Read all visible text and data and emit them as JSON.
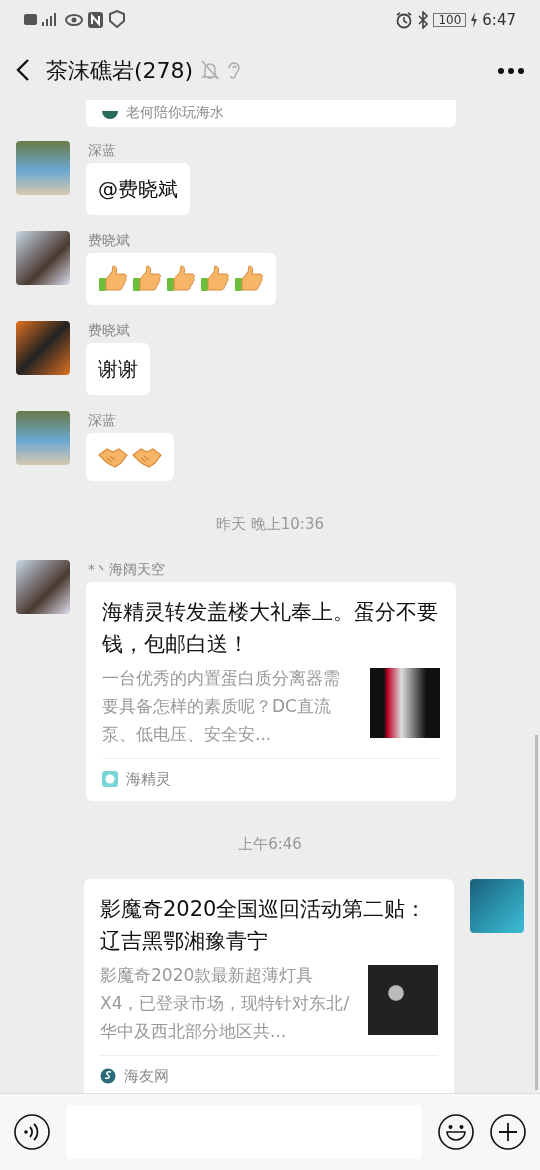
{
  "status_bar": {
    "battery": "100",
    "time": "6:47"
  },
  "header": {
    "title": "茶沫礁岩(278)"
  },
  "messages": [
    {
      "kind": "link_tail",
      "source": "老何陪你玩海水"
    },
    {
      "kind": "text",
      "outgoing": false,
      "sender": "深蓝",
      "text": "@费晓斌"
    },
    {
      "kind": "emoji",
      "outgoing": false,
      "sender": "费晓斌",
      "emoji": [
        {
          "kind": "thumb"
        },
        {
          "kind": "thumb"
        },
        {
          "kind": "thumb"
        },
        {
          "kind": "thumb"
        },
        {
          "kind": "thumb"
        }
      ]
    },
    {
      "kind": "text",
      "outgoing": false,
      "sender": "费晓斌",
      "text": "谢谢"
    },
    {
      "kind": "emoji",
      "outgoing": false,
      "sender": "深蓝",
      "emoji": [
        {
          "kind": "handshake"
        },
        {
          "kind": "handshake"
        }
      ]
    },
    {
      "kind": "time",
      "text": "昨天 晚上10:36"
    },
    {
      "kind": "link",
      "outgoing": false,
      "sender": "*丶海阔天空",
      "title": "海精灵转发盖楼大礼奉上。蛋分不要钱，包邮白送！",
      "description": "一台优秀的内置蛋白质分离器需要具备怎样的素质呢？DC直流泵、低电压、安全安...",
      "source": "海精灵"
    },
    {
      "kind": "time",
      "text": "上午6:46"
    },
    {
      "kind": "link",
      "outgoing": true,
      "title": "影魔奇2020全国巡回活动第二贴：辽吉黑鄂湘豫青宁",
      "description": "影魔奇2020款最新超薄灯具X4，已登录市场，现特针对东北/华中及西北部分地区共...",
      "source": "海友网"
    }
  ]
}
